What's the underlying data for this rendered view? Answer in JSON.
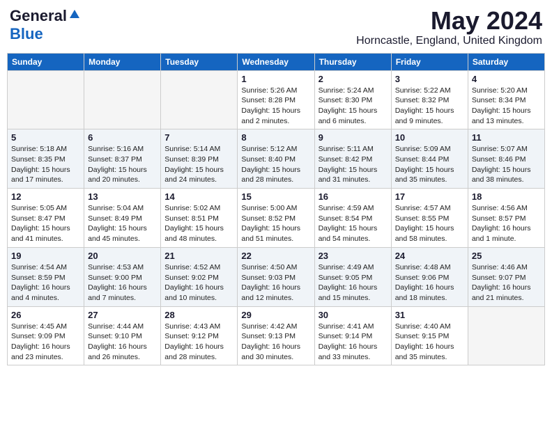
{
  "header": {
    "logo_general": "General",
    "logo_blue": "Blue",
    "month_title": "May 2024",
    "location": "Horncastle, England, United Kingdom"
  },
  "days_of_week": [
    "Sunday",
    "Monday",
    "Tuesday",
    "Wednesday",
    "Thursday",
    "Friday",
    "Saturday"
  ],
  "weeks": [
    {
      "shade": false,
      "days": [
        {
          "num": "",
          "info": ""
        },
        {
          "num": "",
          "info": ""
        },
        {
          "num": "",
          "info": ""
        },
        {
          "num": "1",
          "info": "Sunrise: 5:26 AM\nSunset: 8:28 PM\nDaylight: 15 hours\nand 2 minutes."
        },
        {
          "num": "2",
          "info": "Sunrise: 5:24 AM\nSunset: 8:30 PM\nDaylight: 15 hours\nand 6 minutes."
        },
        {
          "num": "3",
          "info": "Sunrise: 5:22 AM\nSunset: 8:32 PM\nDaylight: 15 hours\nand 9 minutes."
        },
        {
          "num": "4",
          "info": "Sunrise: 5:20 AM\nSunset: 8:34 PM\nDaylight: 15 hours\nand 13 minutes."
        }
      ]
    },
    {
      "shade": true,
      "days": [
        {
          "num": "5",
          "info": "Sunrise: 5:18 AM\nSunset: 8:35 PM\nDaylight: 15 hours\nand 17 minutes."
        },
        {
          "num": "6",
          "info": "Sunrise: 5:16 AM\nSunset: 8:37 PM\nDaylight: 15 hours\nand 20 minutes."
        },
        {
          "num": "7",
          "info": "Sunrise: 5:14 AM\nSunset: 8:39 PM\nDaylight: 15 hours\nand 24 minutes."
        },
        {
          "num": "8",
          "info": "Sunrise: 5:12 AM\nSunset: 8:40 PM\nDaylight: 15 hours\nand 28 minutes."
        },
        {
          "num": "9",
          "info": "Sunrise: 5:11 AM\nSunset: 8:42 PM\nDaylight: 15 hours\nand 31 minutes."
        },
        {
          "num": "10",
          "info": "Sunrise: 5:09 AM\nSunset: 8:44 PM\nDaylight: 15 hours\nand 35 minutes."
        },
        {
          "num": "11",
          "info": "Sunrise: 5:07 AM\nSunset: 8:46 PM\nDaylight: 15 hours\nand 38 minutes."
        }
      ]
    },
    {
      "shade": false,
      "days": [
        {
          "num": "12",
          "info": "Sunrise: 5:05 AM\nSunset: 8:47 PM\nDaylight: 15 hours\nand 41 minutes."
        },
        {
          "num": "13",
          "info": "Sunrise: 5:04 AM\nSunset: 8:49 PM\nDaylight: 15 hours\nand 45 minutes."
        },
        {
          "num": "14",
          "info": "Sunrise: 5:02 AM\nSunset: 8:51 PM\nDaylight: 15 hours\nand 48 minutes."
        },
        {
          "num": "15",
          "info": "Sunrise: 5:00 AM\nSunset: 8:52 PM\nDaylight: 15 hours\nand 51 minutes."
        },
        {
          "num": "16",
          "info": "Sunrise: 4:59 AM\nSunset: 8:54 PM\nDaylight: 15 hours\nand 54 minutes."
        },
        {
          "num": "17",
          "info": "Sunrise: 4:57 AM\nSunset: 8:55 PM\nDaylight: 15 hours\nand 58 minutes."
        },
        {
          "num": "18",
          "info": "Sunrise: 4:56 AM\nSunset: 8:57 PM\nDaylight: 16 hours\nand 1 minute."
        }
      ]
    },
    {
      "shade": true,
      "days": [
        {
          "num": "19",
          "info": "Sunrise: 4:54 AM\nSunset: 8:59 PM\nDaylight: 16 hours\nand 4 minutes."
        },
        {
          "num": "20",
          "info": "Sunrise: 4:53 AM\nSunset: 9:00 PM\nDaylight: 16 hours\nand 7 minutes."
        },
        {
          "num": "21",
          "info": "Sunrise: 4:52 AM\nSunset: 9:02 PM\nDaylight: 16 hours\nand 10 minutes."
        },
        {
          "num": "22",
          "info": "Sunrise: 4:50 AM\nSunset: 9:03 PM\nDaylight: 16 hours\nand 12 minutes."
        },
        {
          "num": "23",
          "info": "Sunrise: 4:49 AM\nSunset: 9:05 PM\nDaylight: 16 hours\nand 15 minutes."
        },
        {
          "num": "24",
          "info": "Sunrise: 4:48 AM\nSunset: 9:06 PM\nDaylight: 16 hours\nand 18 minutes."
        },
        {
          "num": "25",
          "info": "Sunrise: 4:46 AM\nSunset: 9:07 PM\nDaylight: 16 hours\nand 21 minutes."
        }
      ]
    },
    {
      "shade": false,
      "days": [
        {
          "num": "26",
          "info": "Sunrise: 4:45 AM\nSunset: 9:09 PM\nDaylight: 16 hours\nand 23 minutes."
        },
        {
          "num": "27",
          "info": "Sunrise: 4:44 AM\nSunset: 9:10 PM\nDaylight: 16 hours\nand 26 minutes."
        },
        {
          "num": "28",
          "info": "Sunrise: 4:43 AM\nSunset: 9:12 PM\nDaylight: 16 hours\nand 28 minutes."
        },
        {
          "num": "29",
          "info": "Sunrise: 4:42 AM\nSunset: 9:13 PM\nDaylight: 16 hours\nand 30 minutes."
        },
        {
          "num": "30",
          "info": "Sunrise: 4:41 AM\nSunset: 9:14 PM\nDaylight: 16 hours\nand 33 minutes."
        },
        {
          "num": "31",
          "info": "Sunrise: 4:40 AM\nSunset: 9:15 PM\nDaylight: 16 hours\nand 35 minutes."
        },
        {
          "num": "",
          "info": ""
        }
      ]
    }
  ]
}
